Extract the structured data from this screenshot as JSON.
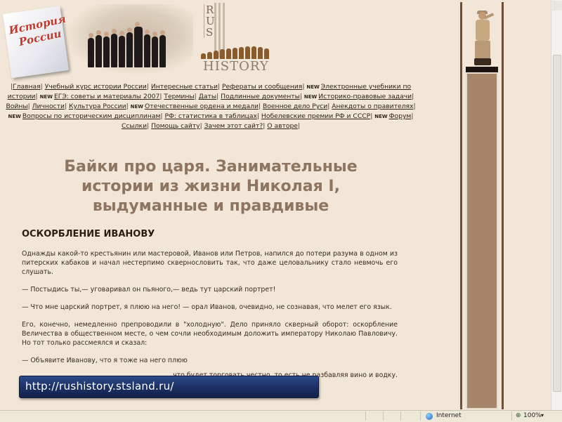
{
  "logo": {
    "line1": "История",
    "line2": "России"
  },
  "brand": {
    "letters": [
      "R",
      "U",
      "S"
    ],
    "history": "HISTORY"
  },
  "nav": [
    {
      "label": "Главная",
      "new": false
    },
    {
      "label": "Учебный курс истории России",
      "new": false
    },
    {
      "label": "Интересные статьи",
      "new": false
    },
    {
      "label": "Рефераты и сообщения",
      "new": false
    },
    {
      "label": "Электронные учебники по истории",
      "new": true
    },
    {
      "label": "ЕГЭ: советы и материалы 2007",
      "new": true
    },
    {
      "label": "Термины",
      "new": false
    },
    {
      "label": "Даты",
      "new": false
    },
    {
      "label": "Подлинные документы",
      "new": false
    },
    {
      "label": "Историко-правовые задачи",
      "new": true
    },
    {
      "label": "Войны",
      "new": false
    },
    {
      "label": "Личности",
      "new": false
    },
    {
      "label": "Культура России",
      "new": false
    },
    {
      "label": "Отечественные ордена и медали",
      "new": true
    },
    {
      "label": "Военное дело Руси",
      "new": false
    },
    {
      "label": "Анекдоты о правителях",
      "new": false
    },
    {
      "label": "Вопросы по историческим дисциплинам",
      "new": true
    },
    {
      "label": "РФ: статистика в таблицах",
      "new": false
    },
    {
      "label": "Нобелевские премии РФ и СССР",
      "new": false
    },
    {
      "label": "Форум",
      "new": true
    },
    {
      "label": "Ссылки",
      "new": false
    },
    {
      "label": "Помощь сайту",
      "new": false
    },
    {
      "label": "Зачем этот сайт?",
      "new": false
    },
    {
      "label": "О авторе",
      "new": false
    }
  ],
  "new_badge": "NEW",
  "page_title": "Байки про царя. Занимательные истории из жизни Николая I, выдуманные и правдивые",
  "section_title": "ОСКОРБЛЕНИЕ ИВАНОВУ",
  "paragraphs": [
    "Однажды какой-то крестьянин или мастеровой, Иванов или Петров, напился до потери разума в одном из питерских кабаков и начал нестерпимо сквернословить так, что даже целовальнику стало невмочь его слушать.",
    "— Постыдись ты,— уговаривал он пьяного,— ведь тут царский портрет!",
    "— Что мне царский портрет, я плюю на него! — орал Иванов, очевидно, не сознавая, что мелет его язык.",
    "Его, конечно, немедленно препроводили в \"холодную\". Дело приняло скверный оборот: оскорбление Величества в общественном месте, о чем сочли необходимым доложить императору Николаю Павловичу. Но тот только рассмеялся и сказал:",
    "— Объявите Иванову, что я тоже на него плюю",
    "что будет торговать честно, то есть не разбавляя вино и водку."
  ],
  "url_banner": "http://rushistory.stsland.ru/",
  "status": {
    "zone": "Internet",
    "zoom": "100%"
  }
}
